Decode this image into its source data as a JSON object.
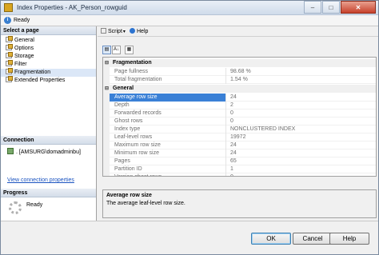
{
  "window": {
    "title": "Index Properties - AK_Person_rowguid",
    "minimize_glyph": "–",
    "maximize_glyph": "□",
    "close_glyph": "✕"
  },
  "status": {
    "icon_glyph": "i",
    "text": "Ready"
  },
  "left": {
    "select_page_header": "Select a page",
    "pages": [
      "General",
      "Options",
      "Storage",
      "Filter",
      "Fragmentation",
      "Extended Properties"
    ],
    "selected_page": "Fragmentation",
    "connection_header": "Connection",
    "server": ". [AMSURG\\domadminbu]",
    "view_connection_link": "View connection properties",
    "progress_header": "Progress",
    "progress_text": "Ready"
  },
  "toolbar": {
    "script_label": "Script",
    "script_arrow": "▾",
    "help_label": "Help"
  },
  "propgrid_toolbar": {
    "categorized_glyph": "▤",
    "alphabetical_glyph": "A↓",
    "pages_glyph": "▦"
  },
  "grid": {
    "categories": [
      {
        "name": "Fragmentation",
        "toggle": "⊟",
        "rows": [
          {
            "name": "Page fullness",
            "value": "98.68 %"
          },
          {
            "name": "Total fragmentation",
            "value": "1.54 %"
          }
        ]
      },
      {
        "name": "General",
        "toggle": "⊟",
        "rows": [
          {
            "name": "Average row size",
            "value": "24"
          },
          {
            "name": "Depth",
            "value": "2"
          },
          {
            "name": "Forwarded records",
            "value": "0"
          },
          {
            "name": "Ghost rows",
            "value": "0"
          },
          {
            "name": "Index type",
            "value": "NONCLUSTERED INDEX"
          },
          {
            "name": "Leaf-level rows",
            "value": "19972"
          },
          {
            "name": "Maximum row size",
            "value": "24"
          },
          {
            "name": "Minimum row size",
            "value": "24"
          },
          {
            "name": "Pages",
            "value": "65"
          },
          {
            "name": "Partition ID",
            "value": "1"
          },
          {
            "name": "Version ghost rows",
            "value": "0"
          }
        ]
      }
    ],
    "selected_row": "Average row size"
  },
  "description": {
    "title": "Average row size",
    "text": "The average leaf-level row size."
  },
  "buttons": {
    "ok": "OK",
    "cancel": "Cancel",
    "help": "Help"
  }
}
